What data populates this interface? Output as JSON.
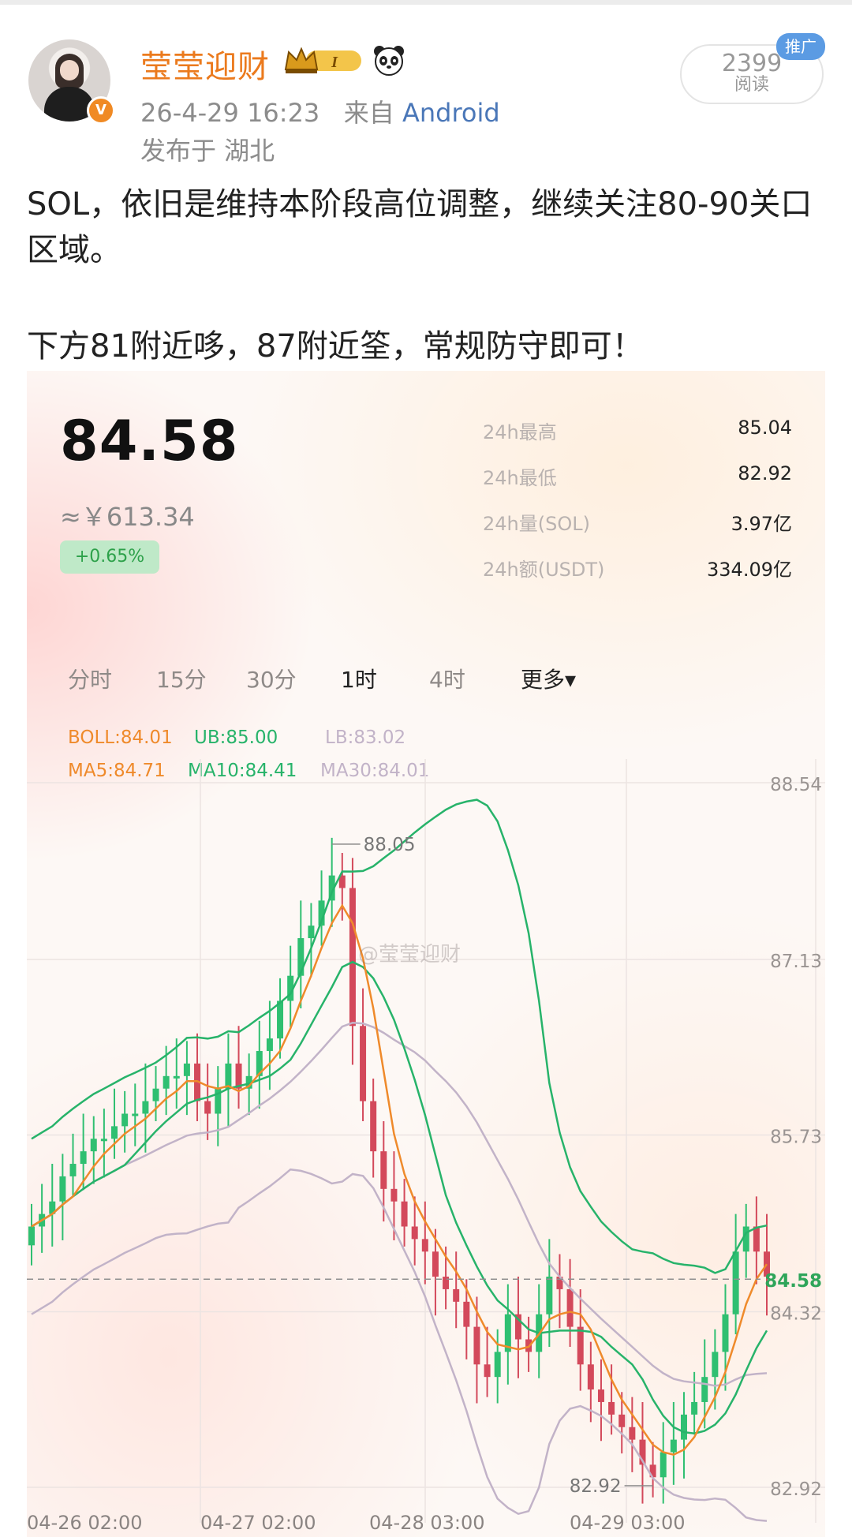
{
  "post": {
    "username": "莹莹迎财",
    "level_badge": "I",
    "verified_mark": "V",
    "time": "26-4-29 16:23",
    "from_label": "来自",
    "source": "Android",
    "location": "发布于 湖北",
    "read_count": "2399",
    "read_label": "阅读",
    "promo_label": "推广",
    "text_line1": "SOL，依旧是维持本阶段高位调整，继续关注80-90关口区域。",
    "text_line2": "下方81附近哆，87附近筌，常规防守即可！",
    "colors": {
      "username": "#eb7a1d",
      "source": "#4a77b8",
      "promo": "#5b9be3"
    }
  },
  "ticker": {
    "price": "84.58",
    "cny": "≈￥613.34",
    "change": "+0.65%",
    "stats": [
      {
        "label": "24h最高",
        "value": "85.04"
      },
      {
        "label": "24h最低",
        "value": "82.92"
      },
      {
        "label": "24h量(SOL)",
        "value": "3.97亿"
      },
      {
        "label": "24h额(USDT)",
        "value": "334.09亿"
      }
    ]
  },
  "tabs": [
    {
      "label": "分时"
    },
    {
      "label": "15分"
    },
    {
      "label": "30分"
    },
    {
      "label": "1时",
      "active": true
    },
    {
      "label": "4时"
    },
    {
      "label": "更多▾"
    }
  ],
  "indicators": {
    "boll": "BOLL:84.01",
    "ub": "UB:85.00",
    "lb": "LB:83.02",
    "ma5": "MA5:84.71",
    "ma10": "MA10:84.41",
    "ma30": "MA30:84.01"
  },
  "watermark": "@莹莹迎财",
  "chart_data": {
    "type": "candlestick",
    "interval": "1时",
    "y_axis_labels": [
      "88.54",
      "87.13",
      "85.73",
      "84.32",
      "82.92"
    ],
    "ylim": [
      82.92,
      88.54
    ],
    "x_axis_labels": [
      "04-26 02:00",
      "04-27 02:00",
      "04-28 03:00",
      "04-29 03:00"
    ],
    "current_price": "84.58",
    "marked_high": "88.05",
    "marked_low": "82.92",
    "close_series_approx": [
      85.0,
      85.1,
      85.2,
      85.4,
      85.5,
      85.6,
      85.7,
      85.7,
      85.8,
      85.9,
      85.9,
      86.0,
      86.1,
      86.2,
      86.2,
      86.3,
      86.0,
      85.9,
      86.1,
      86.3,
      86.1,
      86.2,
      86.4,
      86.5,
      86.8,
      87.0,
      87.3,
      87.4,
      87.6,
      87.8,
      87.7,
      86.6,
      86.0,
      85.6,
      85.3,
      85.2,
      85.0,
      84.9,
      84.8,
      84.6,
      84.5,
      84.4,
      84.2,
      83.9,
      83.8,
      84.0,
      84.3,
      84.1,
      84.0,
      84.3,
      84.6,
      84.5,
      84.2,
      83.9,
      83.7,
      83.6,
      83.5,
      83.4,
      83.3,
      83.1,
      83.0,
      83.2,
      83.3,
      83.5,
      83.6,
      83.8,
      84.0,
      84.3,
      84.8,
      85.0,
      84.8,
      84.6
    ],
    "colors": {
      "up": "#2fbf71",
      "down": "#d3495b",
      "ma5": "#ef8a2b",
      "ma10": "#27b36a",
      "boll_mid": "#c2b3c8",
      "boll_band": "#27b36a",
      "lb": "#c2b3c8"
    }
  }
}
